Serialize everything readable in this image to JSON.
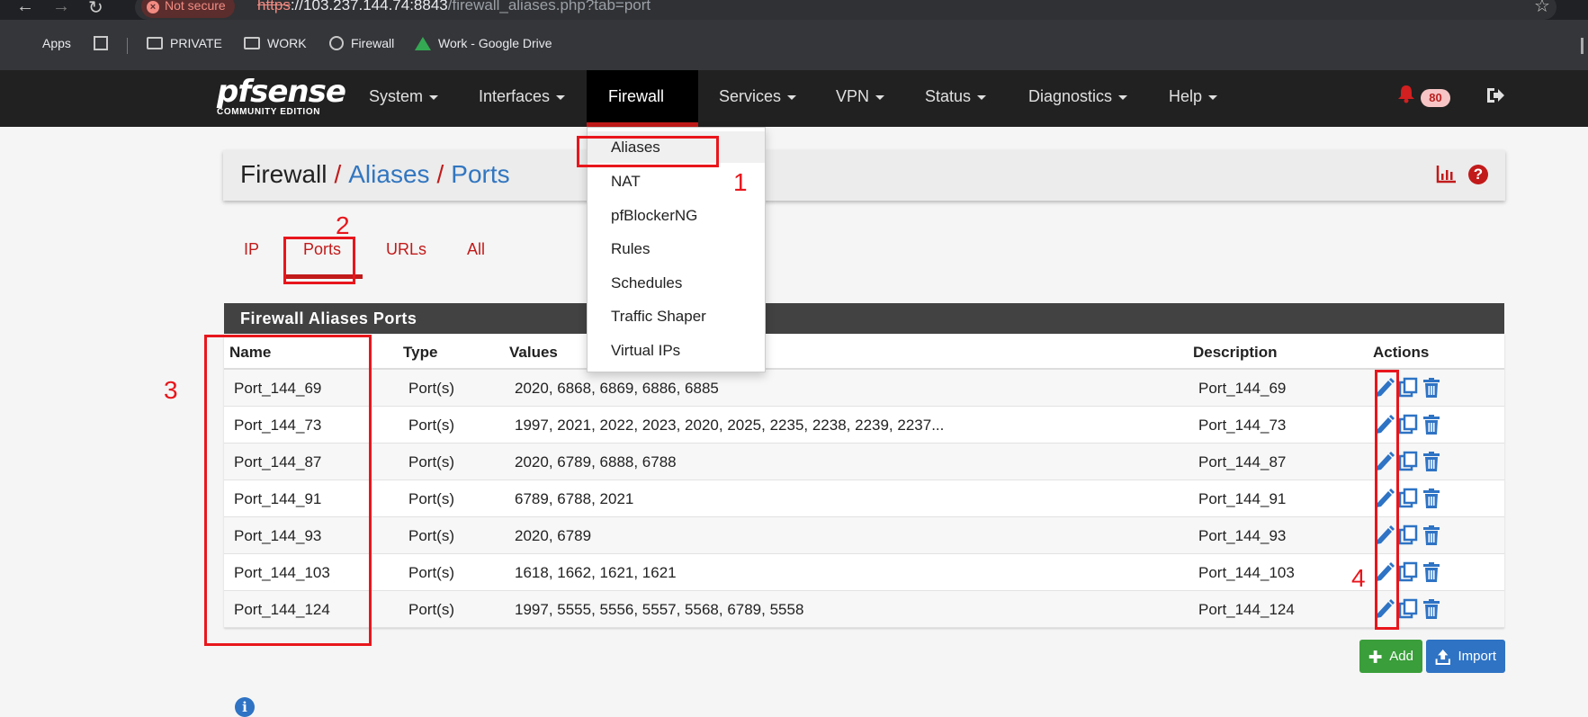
{
  "browser": {
    "security_label": "Not secure",
    "url_scheme": "https",
    "url_host": "://103.237.144.74:8843",
    "url_path": "/firewall_aliases.php?tab=port",
    "bookmarks": [
      "Apps",
      "PRIVATE",
      "WORK",
      "Firewall",
      "Work - Google Drive"
    ]
  },
  "logo": {
    "main": "pfsense",
    "sub": "COMMUNITY EDITION"
  },
  "nav": {
    "items": [
      "System",
      "Interfaces",
      "Firewall",
      "Services",
      "VPN",
      "Status",
      "Diagnostics",
      "Help"
    ],
    "active": "Firewall",
    "notifications": "80"
  },
  "firewall_menu": [
    "Aliases",
    "NAT",
    "pfBlockerNG",
    "Rules",
    "Schedules",
    "Traffic Shaper",
    "Virtual IPs"
  ],
  "breadcrumb": {
    "root": "Firewall",
    "level1": "Aliases",
    "level2": "Ports"
  },
  "tabs": [
    "IP",
    "Ports",
    "URLs",
    "All"
  ],
  "active_tab": "Ports",
  "panel_title": "Firewall Aliases Ports",
  "table": {
    "headers": [
      "Name",
      "Type",
      "Values",
      "Description",
      "Actions"
    ],
    "rows": [
      {
        "name": "Port_144_69",
        "type": "Port(s)",
        "values": "2020, 6868, 6869, 6886, 6885",
        "description": "Port_144_69"
      },
      {
        "name": "Port_144_73",
        "type": "Port(s)",
        "values": "1997, 2021, 2022, 2023, 2020, 2025, 2235, 2238, 2239, 2237...",
        "description": "Port_144_73"
      },
      {
        "name": "Port_144_87",
        "type": "Port(s)",
        "values": "2020, 6789, 6888, 6788",
        "description": "Port_144_87"
      },
      {
        "name": "Port_144_91",
        "type": "Port(s)",
        "values": "6789, 6788, 2021",
        "description": "Port_144_91"
      },
      {
        "name": "Port_144_93",
        "type": "Port(s)",
        "values": "2020, 6789",
        "description": "Port_144_93"
      },
      {
        "name": "Port_144_103",
        "type": "Port(s)",
        "values": "1618, 1662, 1621, 1621",
        "description": "Port_144_103"
      },
      {
        "name": "Port_144_124",
        "type": "Port(s)",
        "values": "1997, 5555, 5556, 5557, 5568, 6789, 5558",
        "description": "Port_144_124"
      }
    ]
  },
  "buttons": {
    "add": "Add",
    "import": "Import"
  },
  "annotations": [
    "1",
    "2",
    "3",
    "4"
  ],
  "colors": {
    "accent": "#c21a1a",
    "link": "#3276c0",
    "navbar": "#212121",
    "annotation": "#e8161c"
  }
}
